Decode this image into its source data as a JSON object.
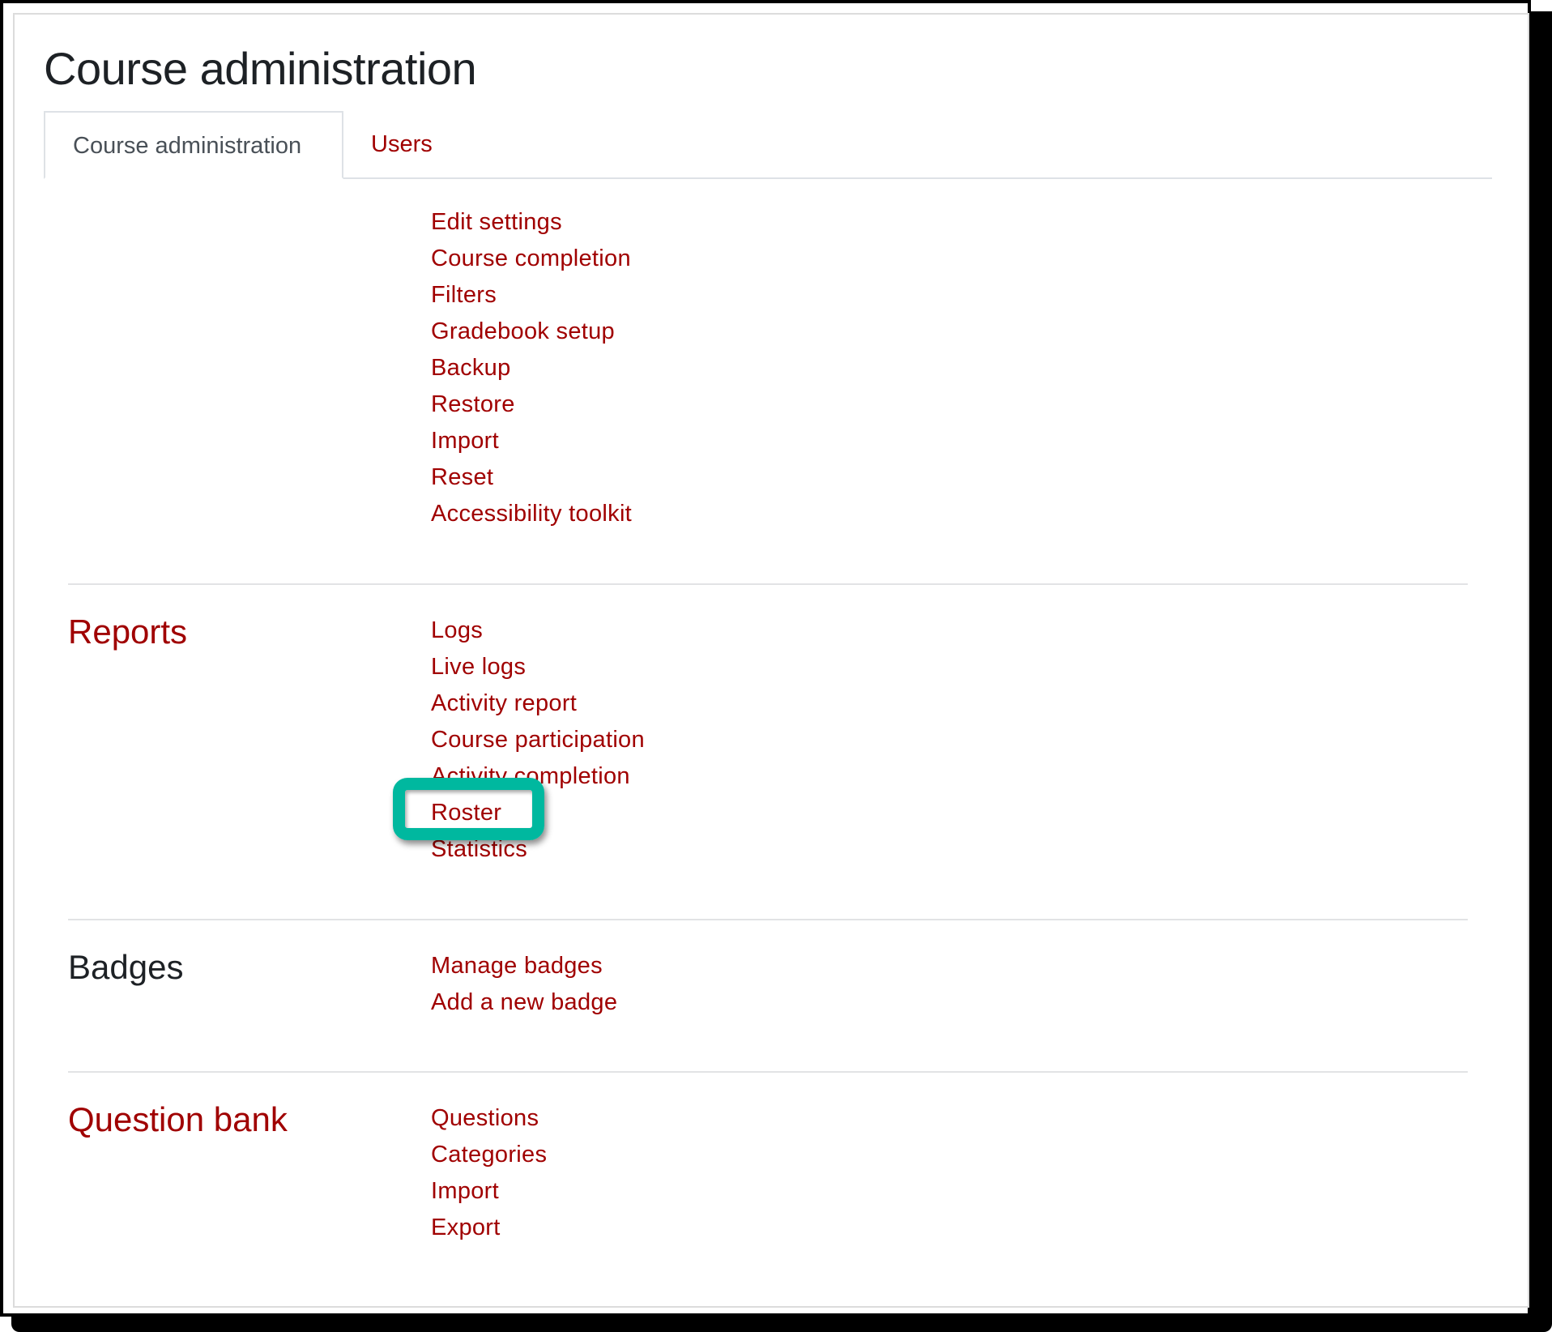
{
  "page": {
    "title": "Course administration",
    "link_color": "#a00000",
    "highlight_color": "#00b89f"
  },
  "tabs": [
    {
      "label": "Course administration",
      "active": true
    },
    {
      "label": "Users",
      "active": false
    }
  ],
  "sections": [
    {
      "heading": "",
      "links": [
        "Edit settings",
        "Course completion",
        "Filters",
        "Gradebook setup",
        "Backup",
        "Restore",
        "Import",
        "Reset",
        "Accessibility toolkit"
      ]
    },
    {
      "heading": "Reports",
      "links": [
        "Logs",
        "Live logs",
        "Activity report",
        "Course participation",
        "Activity completion",
        "Roster",
        "Statistics"
      ]
    },
    {
      "heading": "Badges",
      "links": [
        "Manage badges",
        "Add a new badge"
      ]
    },
    {
      "heading": "Question bank",
      "links": [
        "Questions",
        "Categories",
        "Import",
        "Export"
      ]
    }
  ],
  "annotation": {
    "highlighted_item": "Roster"
  }
}
